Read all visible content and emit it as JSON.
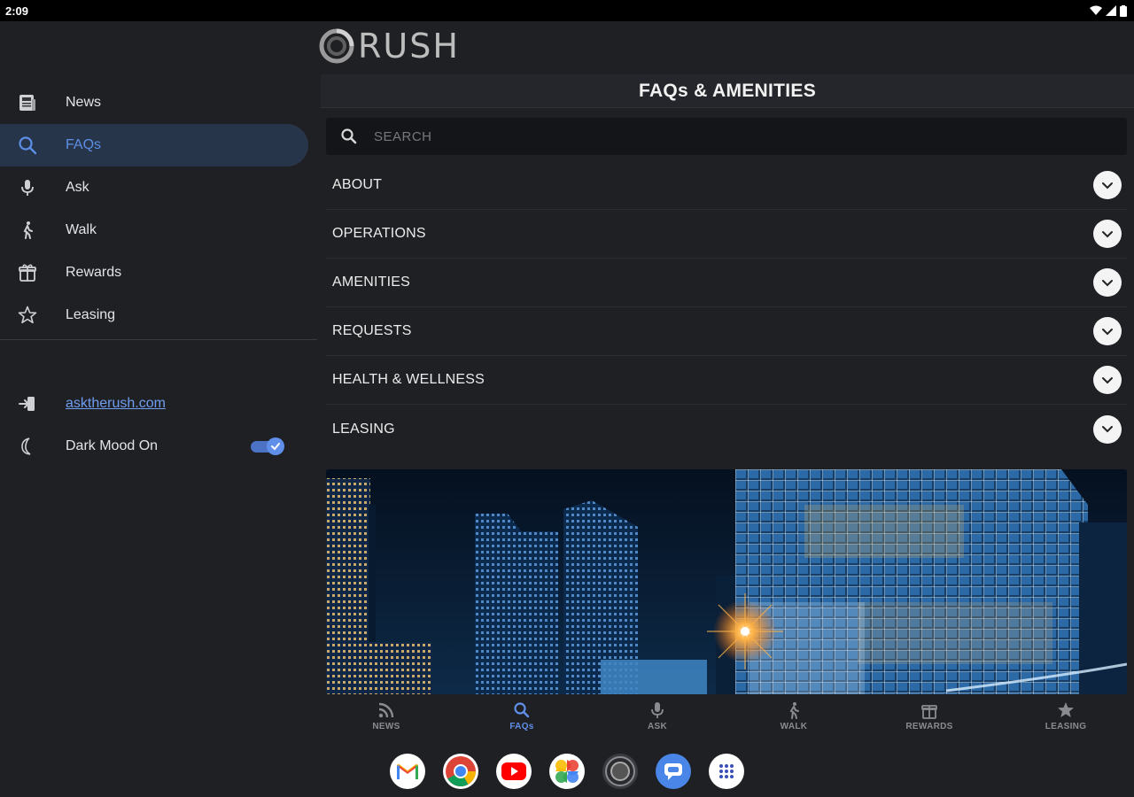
{
  "status_bar": {
    "time": "2:09"
  },
  "drawer": {
    "items": [
      {
        "label": "News",
        "icon": "newspaper-icon",
        "active": false
      },
      {
        "label": "FAQs",
        "icon": "search-icon",
        "active": true
      },
      {
        "label": "Ask",
        "icon": "microphone-icon",
        "active": false
      },
      {
        "label": "Walk",
        "icon": "walking-icon",
        "active": false
      },
      {
        "label": "Rewards",
        "icon": "gift-icon",
        "active": false
      },
      {
        "label": "Leasing",
        "icon": "star-icon",
        "active": false
      }
    ],
    "website_link": "asktherush.com",
    "dark_mode_label": "Dark Mood On",
    "dark_mode_on": true
  },
  "header": {
    "logo_text": "RUSH",
    "title": "FAQs & AMENITIES"
  },
  "search": {
    "placeholder": "SEARCH"
  },
  "faq_sections": [
    {
      "label": "ABOUT"
    },
    {
      "label": "OPERATIONS"
    },
    {
      "label": "AMENITIES"
    },
    {
      "label": "REQUESTS"
    },
    {
      "label": "HEALTH & WELLNESS"
    },
    {
      "label": "LEASING"
    }
  ],
  "bottom_nav": [
    {
      "label": "NEWS",
      "icon": "rss-icon",
      "active": false
    },
    {
      "label": "FAQs",
      "icon": "search-icon",
      "active": true
    },
    {
      "label": "ASK",
      "icon": "microphone-icon",
      "active": false
    },
    {
      "label": "WALK",
      "icon": "walking-icon",
      "active": false
    },
    {
      "label": "REWARDS",
      "icon": "gift-icon",
      "active": false
    },
    {
      "label": "LEASING",
      "icon": "star-icon",
      "active": false
    }
  ],
  "dock_apps": [
    {
      "name": "Gmail",
      "icon": "gmail-icon"
    },
    {
      "name": "Chrome",
      "icon": "chrome-icon"
    },
    {
      "name": "YouTube",
      "icon": "youtube-icon"
    },
    {
      "name": "Photos",
      "icon": "photos-icon"
    },
    {
      "name": "Camera",
      "icon": "camera-icon"
    },
    {
      "name": "Messages",
      "icon": "messages-icon"
    },
    {
      "name": "App drawer",
      "icon": "app-grid-icon"
    }
  ],
  "colors": {
    "accent": "#5f8fe8",
    "background": "#1f2024",
    "active_nav_bg": "#27354a"
  }
}
